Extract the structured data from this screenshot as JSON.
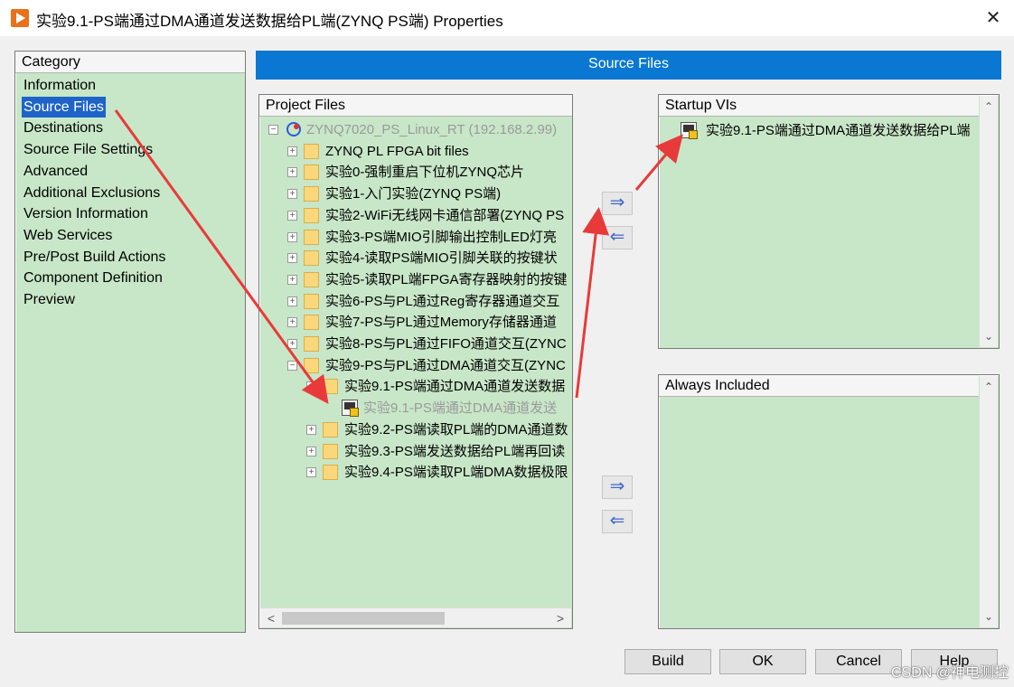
{
  "window": {
    "title": "实验9.1-PS端通过DMA通道发送数据给PL端(ZYNQ PS端) Properties",
    "close_symbol": "✕"
  },
  "category": {
    "header": "Category",
    "items": [
      {
        "label": "Information"
      },
      {
        "label": "Source Files",
        "selected": true
      },
      {
        "label": "Destinations"
      },
      {
        "label": "Source File Settings"
      },
      {
        "label": "Advanced"
      },
      {
        "label": "Additional Exclusions"
      },
      {
        "label": "Version Information"
      },
      {
        "label": "Web Services"
      },
      {
        "label": "Pre/Post Build Actions"
      },
      {
        "label": "Component Definition"
      },
      {
        "label": "Preview"
      }
    ]
  },
  "page_banner": "Source Files",
  "project_files": {
    "header": "Project Files",
    "rows": [
      {
        "label": "ZYNQ7020_PS_Linux_RT (192.168.2.99)",
        "icon": "target-icon",
        "expander": "−",
        "grey": true
      },
      {
        "label": "ZYNQ PL FPGA bit files",
        "icon": "folder-icon",
        "expander": "+"
      },
      {
        "label": "实验0-强制重启下位机ZYNQ芯片",
        "icon": "folder-icon",
        "expander": "+"
      },
      {
        "label": "实验1-入门实验(ZYNQ PS端)",
        "icon": "folder-icon",
        "expander": "+"
      },
      {
        "label": "实验2-WiFi无线网卡通信部署(ZYNQ PS",
        "icon": "folder-icon",
        "expander": "+"
      },
      {
        "label": "实验3-PS端MIO引脚输出控制LED灯亮",
        "icon": "folder-icon",
        "expander": "+"
      },
      {
        "label": "实验4-读取PS端MIO引脚关联的按键状",
        "icon": "folder-icon",
        "expander": "+"
      },
      {
        "label": "实验5-读取PL端FPGA寄存器映射的按键",
        "icon": "folder-icon",
        "expander": "+"
      },
      {
        "label": "实验6-PS与PL通过Reg寄存器通道交互",
        "icon": "folder-icon",
        "expander": "+"
      },
      {
        "label": "实验7-PS与PL通过Memory存储器通道",
        "icon": "folder-icon",
        "expander": "+"
      },
      {
        "label": "实验8-PS与PL通过FIFO通道交互(ZYNC",
        "icon": "folder-icon",
        "expander": "+"
      },
      {
        "label": "实验9-PS与PL通过DMA通道交互(ZYNC",
        "icon": "folder-icon",
        "expander": "−"
      },
      {
        "label": "实验9.1-PS端通过DMA通道发送数据",
        "icon": "folder-icon",
        "expander": "−"
      },
      {
        "label": "实验9.1-PS端通过DMA通道发送",
        "icon": "vi-icon",
        "grey": true
      },
      {
        "label": "实验9.2-PS端读取PL端的DMA通道数",
        "icon": "folder-icon",
        "expander": "+"
      },
      {
        "label": "实验9.3-PS端发送数据给PL端再回读",
        "icon": "folder-icon",
        "expander": "+"
      },
      {
        "label": "实验9.4-PS端读取PL端DMA数据极限",
        "icon": "folder-icon",
        "expander": "+"
      }
    ],
    "scroll_left": "<",
    "scroll_right": ">"
  },
  "startup_vis": {
    "header": "Startup VIs",
    "items": [
      {
        "label": "实验9.1-PS端通过DMA通道发送数据给PL端",
        "icon": "vi-icon"
      }
    ],
    "scroll_up": "⌃",
    "scroll_down": "⌄"
  },
  "always_included": {
    "header": "Always Included",
    "items": [],
    "scroll_up": "⌃",
    "scroll_down": "⌄"
  },
  "move_buttons": {
    "add": "⇒",
    "remove": "⇐"
  },
  "buttons": {
    "build": "Build",
    "ok": "OK",
    "cancel": "Cancel",
    "help": "Help"
  },
  "watermark": "CSDN @神电测控",
  "colors": {
    "panel_green": "#c8e6c8",
    "banner_blue": "#0a78d2",
    "selection_blue": "#1e64c8",
    "annotation_red": "#e83a3a"
  }
}
